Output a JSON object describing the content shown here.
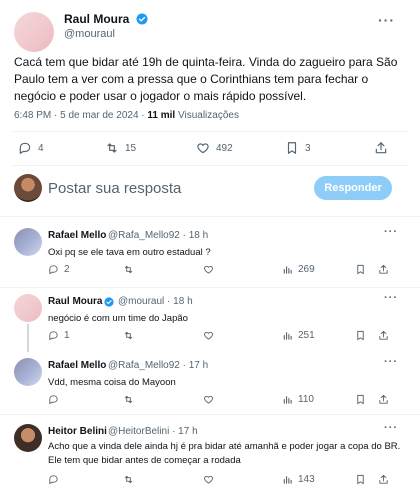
{
  "main_tweet": {
    "author": "Raul Moura",
    "handle": "@mouraul",
    "text": "Cacá tem que bidar até 19h de quinta-feira. Vinda do zagueiro para São Paulo tem a ver com a pressa que o Corinthians tem para fechar o negócio e poder usar o jogador o mais rápido possível.",
    "time": "6:48 PM · 5 de mar de 2024 · ",
    "views_count": "11 mil",
    "views_label": "Visualizações",
    "replies": "4",
    "reposts": "15",
    "likes": "492",
    "bookmarks": "3"
  },
  "compose": {
    "placeholder": "Postar sua resposta",
    "button": "Responder"
  },
  "replies": [
    {
      "author": "Rafael Mello",
      "handle": "@Rafa_Mello92 · 18 h",
      "text": "Oxi pq se ele tava em outro estadual ?",
      "replies": "2",
      "views": "269"
    },
    {
      "author": "Raul Moura",
      "handle": "@mouraul · 18 h",
      "text": "negócio é com um time do Japão",
      "replies": "1",
      "views": "251"
    },
    {
      "author": "Rafael Mello",
      "handle": "@Rafa_Mello92 · 17 h",
      "text": "Vdd, mesma coisa do Mayoon",
      "replies": "",
      "views": "110"
    },
    {
      "author": "Heitor Belini",
      "handle": "@HeitorBelini · 17 h",
      "text": "Acho que a vinda dele ainda hj é pra bidar até amanhã e poder jogar a copa do BR. Ele tem que bidar antes de começar a rodada",
      "replies": "",
      "views": "143"
    }
  ],
  "colors": {
    "accent": "#1d9bf0",
    "text_secondary": "#536471",
    "reply_button": "#8ecdf8"
  },
  "icons": [
    "verified-badge-icon",
    "more-icon",
    "reply-icon",
    "repost-icon",
    "like-icon",
    "bookmark-icon",
    "share-icon",
    "views-icon"
  ]
}
